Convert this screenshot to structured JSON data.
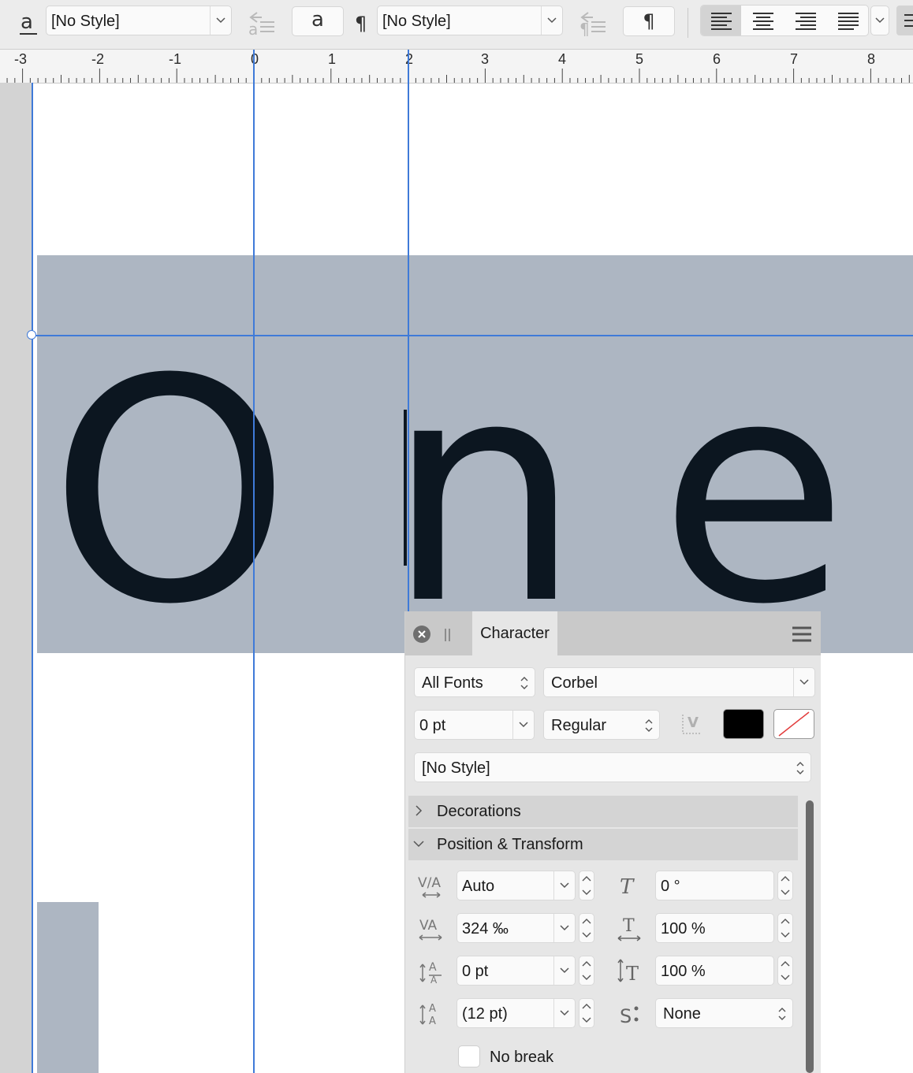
{
  "toolbar": {
    "char_style_value": "[No Style]",
    "para_style_value": "[No Style]",
    "char_button_glyph": "a",
    "para_button_glyph": "¶"
  },
  "ruler": {
    "labels": [
      "-3",
      "-2",
      "-1",
      "0",
      "1",
      "2",
      "3",
      "4",
      "5",
      "6",
      "7",
      "8"
    ]
  },
  "canvas": {
    "letters": [
      "O",
      "n",
      "e"
    ]
  },
  "panel": {
    "tab_label": "Character",
    "font_collection": "All Fonts",
    "font_family": "Corbel",
    "font_size": "0 pt",
    "font_style": "Regular",
    "text_style": "[No Style]",
    "fill_color": "#000000",
    "sections": {
      "decorations": "Decorations",
      "position_transform": "Position & Transform"
    },
    "fields": {
      "kerning": "Auto",
      "shear": "0 °",
      "tracking": "324 ‰",
      "vertical_scale": "100 %",
      "baseline_shift": "0 pt",
      "horizontal_scale": "100 %",
      "leading": "(12 pt)",
      "script": "None"
    },
    "no_break_label": "No break",
    "no_break_checked": false
  },
  "colors": {
    "accent_guide": "#3f7ad8",
    "frame_fill": "#adb6c2",
    "glyph_fill": "#0c1620"
  }
}
